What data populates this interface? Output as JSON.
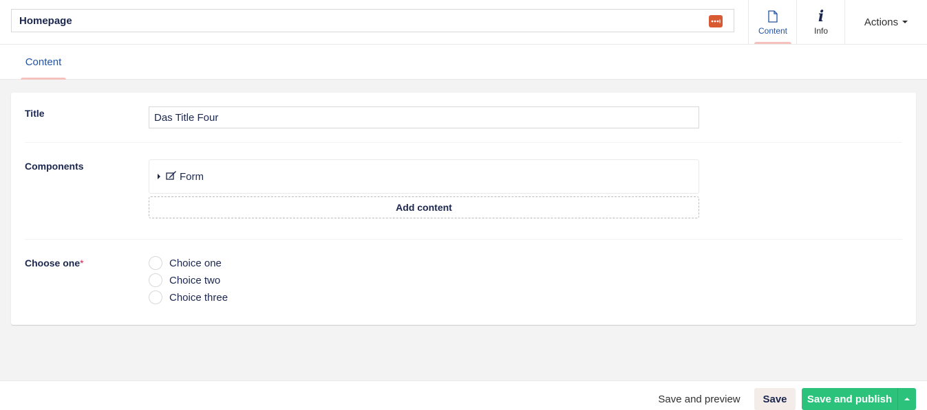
{
  "header": {
    "page_name": "Homepage",
    "apps": [
      {
        "label": "Content",
        "icon": "document-icon",
        "active": true
      },
      {
        "label": "Info",
        "icon": "info-icon",
        "active": false
      }
    ],
    "actions_label": "Actions"
  },
  "tabs": [
    {
      "label": "Content"
    }
  ],
  "properties": {
    "title": {
      "label": "Title",
      "value": "Das Title Four"
    },
    "components": {
      "label": "Components",
      "blocks": [
        {
          "label": "Form",
          "icon": "form-icon"
        }
      ],
      "add_label": "Add content"
    },
    "choose_one": {
      "label": "Choose one",
      "required_marker": "*",
      "options": [
        "Choice one",
        "Choice two",
        "Choice three"
      ]
    }
  },
  "footer": {
    "preview_label": "Save and preview",
    "save_label": "Save",
    "publish_label": "Save and publish"
  },
  "colors": {
    "accent": "#2152a3",
    "publish": "#2bc37c",
    "dots_badge": "#d75a33",
    "active_underline": "#f5c1bc"
  }
}
